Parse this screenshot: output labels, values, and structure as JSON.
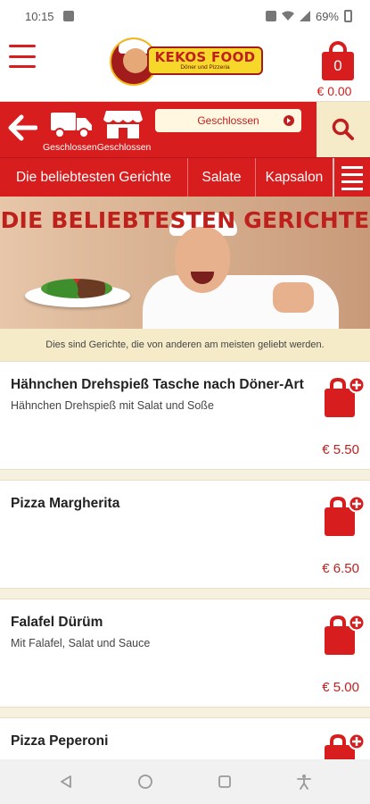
{
  "status_bar": {
    "time": "10:15",
    "battery": "69%"
  },
  "header": {
    "logo_title": "KEKOS FOOD",
    "logo_subtitle": "Döner und Pizzeria",
    "cart_count": "0",
    "cart_total": "€ 0.00"
  },
  "toolbar": {
    "delivery_mode_labels": "GeschlossenGeschlossen",
    "status_select_value": "Geschlossen"
  },
  "categories": [
    {
      "label": "Die beliebtesten Gerichte"
    },
    {
      "label": "Salate"
    },
    {
      "label": "Kapsalon"
    }
  ],
  "hero": {
    "title": "DIE BELIEBTESTEN GERICHTE"
  },
  "section_description": "Dies sind Gerichte, die von anderen am meisten geliebt werden.",
  "items": [
    {
      "name": "Hähnchen Drehspieß Tasche nach Döner-Art",
      "description": "Hähnchen Drehspieß mit Salat und Soße",
      "price": "€ 5.50"
    },
    {
      "name": "Pizza Margherita",
      "description": "",
      "price": "€ 6.50"
    },
    {
      "name": "Falafel Dürüm",
      "description": "Mit Falafel, Salat und Sauce",
      "price": "€ 5.00"
    },
    {
      "name": "Pizza Peperoni",
      "description": "",
      "price": ""
    }
  ],
  "colors": {
    "brand_red": "#d71d1d",
    "cream": "#f6ebc9",
    "background": "#f6f1df"
  }
}
